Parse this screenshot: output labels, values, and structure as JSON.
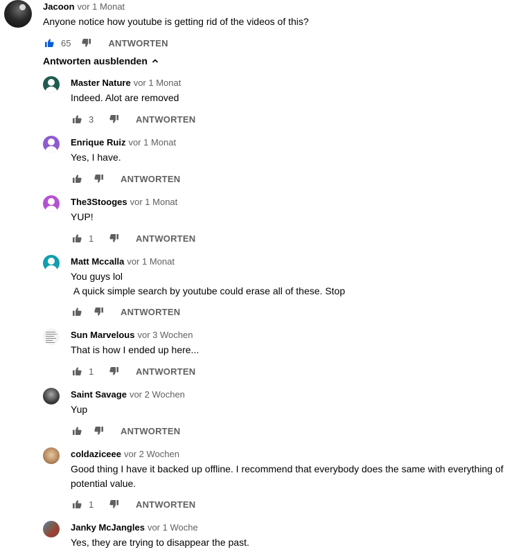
{
  "colors": {
    "like_active": "#065fd4",
    "muted": "#606060",
    "avatar_master_nature": "#1f5b4e",
    "avatar_enrique": "#8e5bd1",
    "avatar_the3stooges": "#b453d1",
    "avatar_matt": "#129eaf"
  },
  "top_comment": {
    "author": "Jacoon",
    "time": "vor 1 Monat",
    "text": "Anyone notice how youtube is getting rid of the videos of this?",
    "likes": "65",
    "like_icon": "thumbs-up-icon",
    "dislike_icon": "thumbs-down-icon",
    "reply_label": "ANTWORTEN"
  },
  "toggle_replies_label": "Antworten ausblenden",
  "replies": [
    {
      "author": "Master Nature",
      "time": "vor 1 Monat",
      "text": "Indeed. Alot are removed",
      "likes": "3",
      "reply_label": "ANTWORTEN"
    },
    {
      "author": "Enrique Ruiz",
      "time": "vor 1 Monat",
      "text": "Yes, I have.",
      "likes": "",
      "reply_label": "ANTWORTEN"
    },
    {
      "author": "The3Stooges",
      "time": "vor 1 Monat",
      "text": "YUP!",
      "likes": "1",
      "reply_label": "ANTWORTEN"
    },
    {
      "author": "Matt Mccalla",
      "time": "vor 1 Monat",
      "text": "You guys lol\n A quick simple search by youtube could erase all of these. Stop",
      "likes": "",
      "reply_label": "ANTWORTEN"
    },
    {
      "author": "Sun Marvelous",
      "time": "vor 3 Wochen",
      "text": "That is how I ended up here...",
      "likes": "1",
      "reply_label": "ANTWORTEN"
    },
    {
      "author": "Saint Savage",
      "time": "vor 2 Wochen",
      "text": "Yup",
      "likes": "",
      "reply_label": "ANTWORTEN"
    },
    {
      "author": "coldaziceee",
      "time": "vor 2 Wochen",
      "text": "Good thing I have it backed up offline. I recommend that everybody does the same with everything of potential value.",
      "likes": "1",
      "reply_label": "ANTWORTEN"
    },
    {
      "author": "Janky McJangles",
      "time": "vor 1 Woche",
      "text": "Yes, they are trying to disappear the past.",
      "likes": "",
      "reply_label": ""
    }
  ]
}
